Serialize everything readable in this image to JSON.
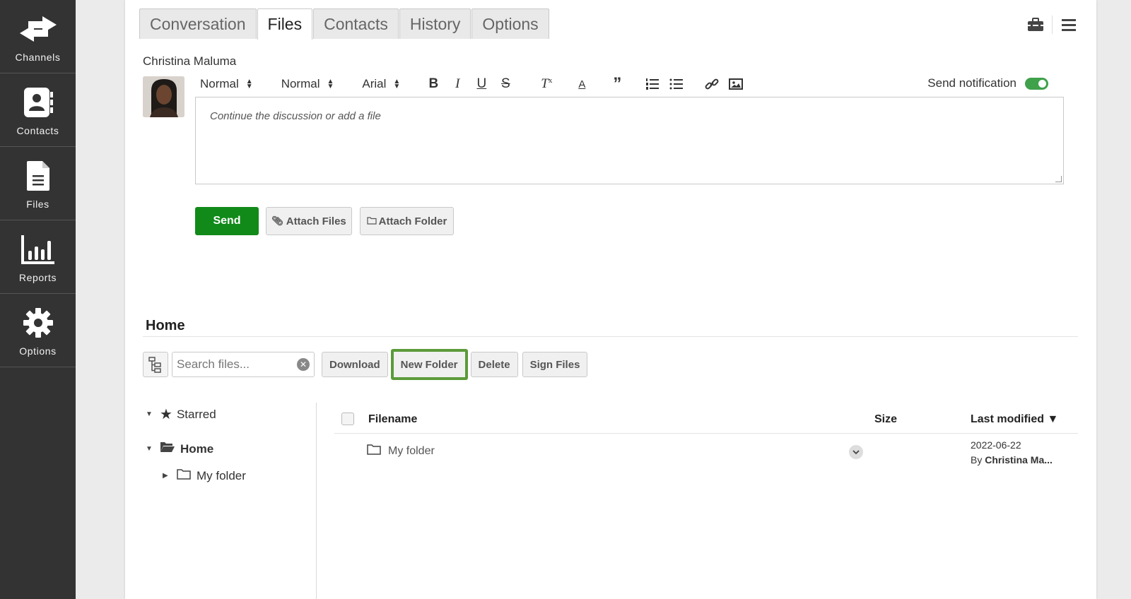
{
  "sidebar": {
    "items": [
      {
        "label": "Channels",
        "icon": "arrows-left-right-icon"
      },
      {
        "label": "Contacts",
        "icon": "address-book-icon"
      },
      {
        "label": "Files",
        "icon": "document-icon"
      },
      {
        "label": "Reports",
        "icon": "bar-chart-icon"
      },
      {
        "label": "Options",
        "icon": "gear-icon"
      }
    ]
  },
  "tabs": [
    {
      "label": "Conversation",
      "active": false
    },
    {
      "label": "Files",
      "active": true
    },
    {
      "label": "Contacts",
      "active": false
    },
    {
      "label": "History",
      "active": false
    },
    {
      "label": "Options",
      "active": false
    }
  ],
  "conversation": {
    "recipient": "Christina Maluma",
    "toolbar": {
      "header_select": "Normal",
      "size_select": "Normal",
      "font_select": "Arial",
      "send_notification_label": "Send notification",
      "send_notification_on": true
    },
    "editor_placeholder": "Continue the discussion or add a file",
    "send_label": "Send",
    "attach_files_label": "Attach Files",
    "attach_folder_label": "Attach Folder"
  },
  "files": {
    "section_title": "Home",
    "search_placeholder": "Search files...",
    "buttons": {
      "download": "Download",
      "new_folder": "New Folder",
      "delete": "Delete",
      "sign_files": "Sign Files"
    },
    "tree": {
      "starred": "Starred",
      "home": "Home",
      "my_folder": "My folder"
    },
    "columns": {
      "filename": "Filename",
      "size": "Size",
      "last_modified": "Last modified ▼"
    },
    "rows": [
      {
        "name": "My folder",
        "size": "",
        "date": "2022-06-22",
        "by_prefix": "By",
        "by_name": "Christina Ma..."
      }
    ]
  },
  "colors": {
    "sidebar_bg": "#333333",
    "send_green": "#118a19",
    "highlight_green": "#5c9a3a",
    "toggle_green": "#3fa14a"
  }
}
